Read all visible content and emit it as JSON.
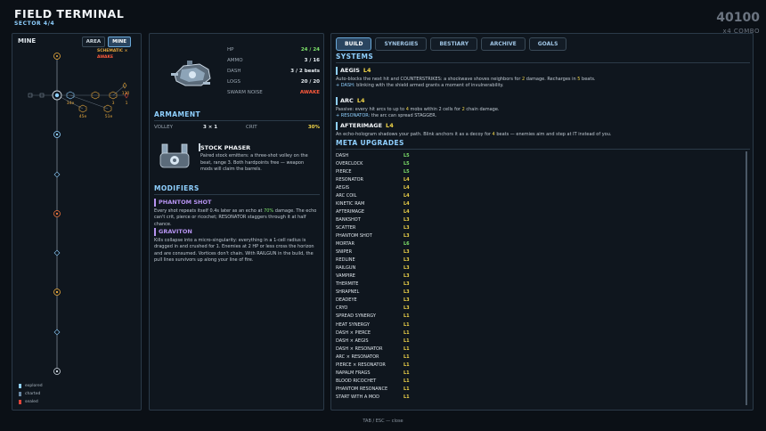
{
  "header": {
    "title": "FIELD TERMINAL",
    "subtitle": "SECTOR 4/4",
    "score": "40100",
    "combo": "x4 COMBO"
  },
  "map_panel": {
    "title": "MINE",
    "tabs": [
      {
        "label": "AREA",
        "active": false
      },
      {
        "label": "MINE",
        "active": true
      }
    ],
    "schematic": "SCHEMATIC ×",
    "awake": "AWAKE",
    "nodes": {
      "l1": "34e",
      "l2": "45e",
      "l3": "51e",
      "l4": "130",
      "l5": "3",
      "l6": "1"
    },
    "legend": [
      {
        "label": "explored",
        "color": "#8fd0ff"
      },
      {
        "label": "charted",
        "color": "#6b8aa6"
      },
      {
        "label": "sealed",
        "color": "#e0453a"
      }
    ]
  },
  "ship_panel": {
    "stats": [
      {
        "label": "HP",
        "value": "24 / 24",
        "color": "#7ee36a"
      },
      {
        "label": "AMMO",
        "value": "3 / 16",
        "color": "#e6ecf1"
      },
      {
        "label": "DASH",
        "value": "3 / 2 beats",
        "color": "#e6ecf1"
      },
      {
        "label": "LOGS",
        "value": "20 / 20",
        "color": "#e6ecf1"
      },
      {
        "label": "SWARM NOISE",
        "value": "AWAKE",
        "color": "#ff5a3c"
      }
    ],
    "armament_title": "ARMAMENT",
    "volley_label": "VOLLEY",
    "volley_value": "3 × 1",
    "crit_label": "CRIT",
    "crit_value": "30%",
    "weapon_name": "STOCK PHASER",
    "weapon_desc": "Paired stock emitters: a three-shot volley on the beat, range 3. Both hardpoints free — weapon mods will claim the barrels.",
    "modifiers_title": "MODIFIERS",
    "mods": [
      {
        "name": "PHANTOM SHOT",
        "desc_a": "Every shot repeats itself 0.4s later as an echo at ",
        "desc_hl": "70%",
        "desc_b": " damage. The echo can't crit, pierce or ricochet; RESONATOR staggers through it at half chance."
      },
      {
        "name": "GRAVITON",
        "desc": "Kills collapse into a micro-singularity: everything in a 1-cell radius is dragged in and crushed for 1. Enemies at 2 HP or less cross the horizon and are consumed. Vortices don't chain. With RAILGUN in the build, the pull lines survivors up along your line of fire."
      }
    ]
  },
  "build_panel": {
    "tabs": [
      {
        "label": "BUILD",
        "active": true
      },
      {
        "label": "SYNERGIES",
        "active": false
      },
      {
        "label": "BESTIARY",
        "active": false
      },
      {
        "label": "ARCHIVE",
        "active": false
      },
      {
        "label": "GOALS",
        "active": false
      }
    ],
    "systems_title": "SYSTEMS",
    "systems": [
      {
        "name": "AEGIS",
        "level": "L4",
        "desc_a": "Auto-blocks the next hit and COUNTERSTRIKES: a shockwave shoves neighbors for ",
        "desc_hl": "2",
        "desc_b": " damage. Recharges in ",
        "desc_hl2": "5",
        "desc_c": " beats.",
        "alt_tag": "+ DASH:",
        "alt": " blinking with the shield armed grants a moment of invulnerability."
      },
      {
        "name": "ARC",
        "level": "L4",
        "desc_a": "Passive: every hit arcs to up to ",
        "desc_hl": "4",
        "desc_b": " mobs within 2 cells for ",
        "desc_hl2": "2",
        "desc_c": " chain damage.",
        "alt_tag": "+ RESONATOR:",
        "alt": " the arc can spread STAGGER."
      },
      {
        "name": "AFTERIMAGE",
        "level": "L4",
        "desc_a": "An echo-hologram shadows your path. Blink anchors it as a decoy for ",
        "desc_hl": "4",
        "desc_b": " beats — enemies aim and step at IT instead of you.",
        "desc_hl2": "",
        "desc_c": "",
        "alt_tag": "",
        "alt": ""
      }
    ],
    "meta_title": "META UPGRADES",
    "meta": [
      {
        "name": "DASH",
        "level": "L5"
      },
      {
        "name": "OVERCLOCK",
        "level": "L5"
      },
      {
        "name": "PIERCE",
        "level": "L5"
      },
      {
        "name": "RESONATOR",
        "level": "L4"
      },
      {
        "name": "AEGIS",
        "level": "L4"
      },
      {
        "name": "ARC COIL",
        "level": "L4"
      },
      {
        "name": "KINETIC RAM",
        "level": "L4"
      },
      {
        "name": "AFTERIMAGE",
        "level": "L4"
      },
      {
        "name": "BANKSHOT",
        "level": "L3"
      },
      {
        "name": "SCATTER",
        "level": "L3"
      },
      {
        "name": "PHANTOM SHOT",
        "level": "L3"
      },
      {
        "name": "MORTAR",
        "level": "L6"
      },
      {
        "name": "SNIPER",
        "level": "L3"
      },
      {
        "name": "REDLINE",
        "level": "L3"
      },
      {
        "name": "RAILGUN",
        "level": "L3"
      },
      {
        "name": "VAMPIRE",
        "level": "L3"
      },
      {
        "name": "THERMITE",
        "level": "L3"
      },
      {
        "name": "SHRAPNEL",
        "level": "L3"
      },
      {
        "name": "DEADEYE",
        "level": "L3"
      },
      {
        "name": "CRYO",
        "level": "L3"
      },
      {
        "name": "SPREAD SYNERGY",
        "level": "L1"
      },
      {
        "name": "HEAT SYNERGY",
        "level": "L1"
      },
      {
        "name": "DASH × PIERCE",
        "level": "L1"
      },
      {
        "name": "DASH × AEGIS",
        "level": "L1"
      },
      {
        "name": "DASH × RESONATOR",
        "level": "L1"
      },
      {
        "name": "ARC × RESONATOR",
        "level": "L1"
      },
      {
        "name": "PIERCE × RESONATOR",
        "level": "L1"
      },
      {
        "name": "NAPALM FRAGS",
        "level": "L1"
      },
      {
        "name": "BLOOD RICOCHET",
        "level": "L1"
      },
      {
        "name": "PHANTOM RESONANCE",
        "level": "L1"
      },
      {
        "name": "START WITH A MOD",
        "level": "L1"
      }
    ]
  },
  "footer": "TAB / ESC — close",
  "colors": {
    "accent": "#8fd0ff",
    "lvl5": "#7ee36a",
    "lvl4": "#f0d448",
    "lvl3": "#f0d448",
    "lvl1": "#f0d448",
    "mod": "#b693f0",
    "danger": "#ff5a3c"
  }
}
